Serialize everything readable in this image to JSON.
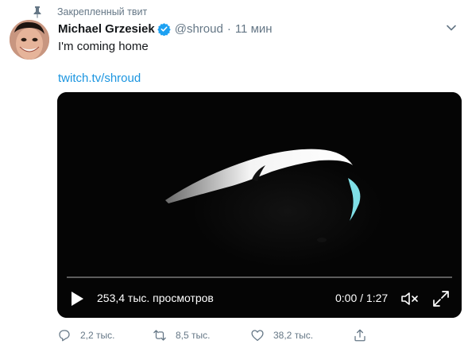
{
  "pinned": {
    "label": "Закрепленный твит",
    "icon": "pin-icon"
  },
  "author": {
    "name": "Michael Grzesiek",
    "handle": "@shroud",
    "separator": "·",
    "time": "11 мин",
    "verified": true,
    "avatar": "avatar"
  },
  "tweet": {
    "text": "I'm coming home",
    "link": "twitch.tv/shroud"
  },
  "video": {
    "views": "253,4 тыс. просмотров",
    "timer": "0:00 / 1:27",
    "progress": 0
  },
  "actions": {
    "reply_count": "2,2 тыс.",
    "retweet_count": "8,5 тыс.",
    "like_count": "38,2 тыс."
  },
  "colors": {
    "link": "#1b95e0",
    "muted": "#657786",
    "verified": "#1da1f2",
    "video_bg": "#050505"
  }
}
